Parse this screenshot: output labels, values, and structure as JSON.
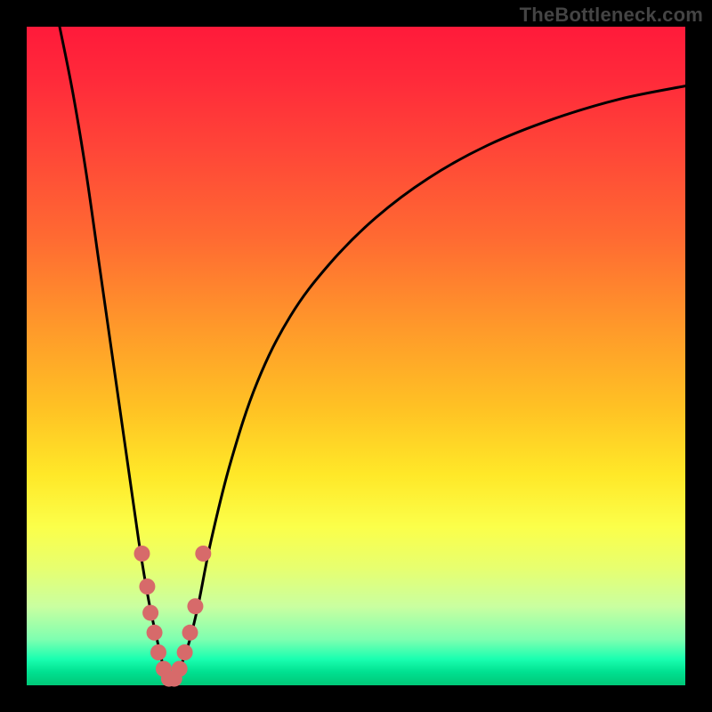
{
  "watermark": "TheBottleneck.com",
  "colors": {
    "background": "#000000",
    "curve": "#000000",
    "marker_fill": "#d76a6a",
    "marker_stroke": "#b84a4a",
    "gradient_top": "#ff1a3a",
    "gradient_bottom": "#00c878"
  },
  "chart_data": {
    "type": "line",
    "title": "",
    "xlabel": "",
    "ylabel": "",
    "xlim": [
      0,
      100
    ],
    "ylim": [
      0,
      100
    ],
    "grid": false,
    "legend": false,
    "note": "No numeric ticks or axis labels are rendered; values are estimated from curve geometry on a 0-100 normalized scale where y=0 is bottom (green) and y=100 is top (red). Two black curves share a near-zero minimum around x≈22; pink markers cluster near the trough.",
    "series": [
      {
        "name": "left-branch",
        "x": [
          5,
          7,
          9,
          11,
          13,
          15,
          17,
          18.5,
          20,
          21,
          22
        ],
        "y": [
          100,
          90,
          78,
          64,
          50,
          36,
          22,
          13,
          6,
          2,
          0
        ]
      },
      {
        "name": "right-branch",
        "x": [
          22,
          23,
          24.5,
          26,
          28,
          31,
          35,
          40,
          46,
          53,
          61,
          70,
          80,
          90,
          100
        ],
        "y": [
          0,
          2,
          6,
          12,
          22,
          34,
          46,
          56,
          64,
          71,
          77,
          82,
          86,
          89,
          91
        ]
      }
    ],
    "markers": {
      "name": "data-points-near-trough",
      "shape": "circle",
      "points": [
        {
          "x": 17.5,
          "y": 20
        },
        {
          "x": 18.3,
          "y": 15
        },
        {
          "x": 18.8,
          "y": 11
        },
        {
          "x": 19.4,
          "y": 8
        },
        {
          "x": 20.0,
          "y": 5
        },
        {
          "x": 20.8,
          "y": 2.5
        },
        {
          "x": 21.6,
          "y": 1
        },
        {
          "x": 22.4,
          "y": 1
        },
        {
          "x": 23.2,
          "y": 2.5
        },
        {
          "x": 24.0,
          "y": 5
        },
        {
          "x": 24.8,
          "y": 8
        },
        {
          "x": 25.6,
          "y": 12
        },
        {
          "x": 26.8,
          "y": 20
        }
      ]
    }
  }
}
